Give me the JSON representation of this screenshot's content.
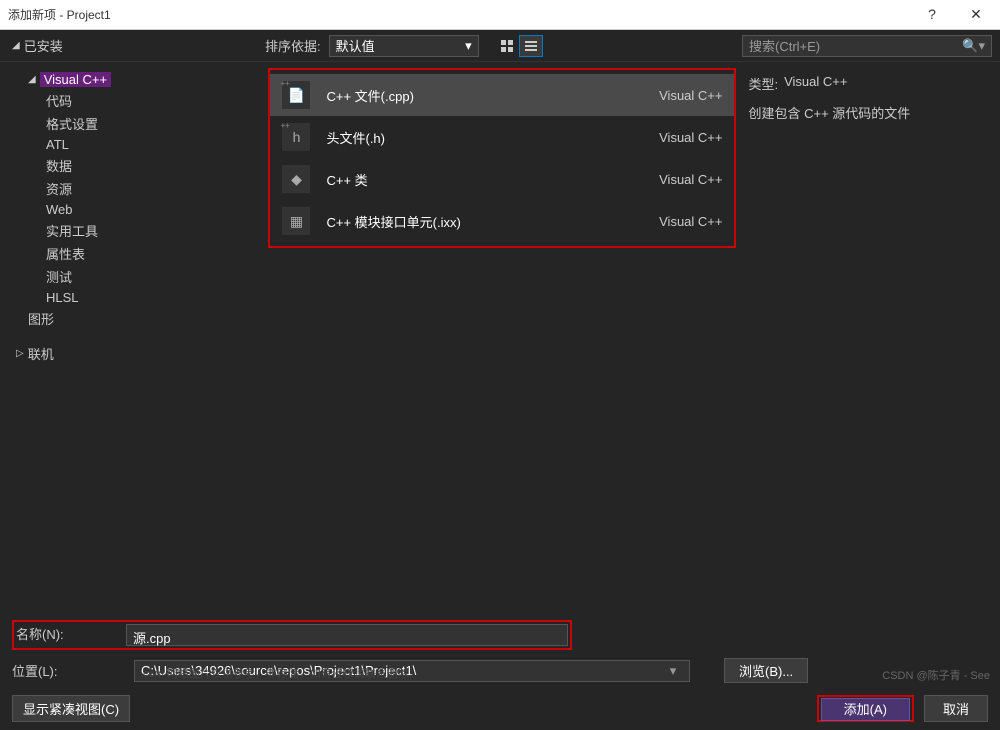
{
  "titlebar": {
    "title": "添加新项 - Project1"
  },
  "toolbar": {
    "installed": "已安装",
    "sort_label": "排序依据:",
    "sort_value": "默认值",
    "search_placeholder": "搜索(Ctrl+E)"
  },
  "sidebar": {
    "root": "Visual C++",
    "items": [
      "代码",
      "格式设置",
      "ATL",
      "数据",
      "资源",
      "Web",
      "实用工具",
      "属性表",
      "测试",
      "HLSL"
    ],
    "graphics": "图形",
    "online": "联机"
  },
  "templates": [
    {
      "name": "C++ 文件(.cpp)",
      "tag": "Visual C++",
      "icon": "cpp",
      "selected": true
    },
    {
      "name": "头文件(.h)",
      "tag": "Visual C++",
      "icon": "h",
      "selected": false
    },
    {
      "name": "C++ 类",
      "tag": "Visual C++",
      "icon": "class",
      "selected": false
    },
    {
      "name": "C++ 模块接口单元(.ixx)",
      "tag": "Visual C++",
      "icon": "module",
      "selected": false
    }
  ],
  "details": {
    "type_label": "类型:",
    "type_value": "Visual C++",
    "desc": "创建包含 C++ 源代码的文件"
  },
  "form": {
    "name_label": "名称(N):",
    "name_value": "源.cpp",
    "location_label": "位置(L):",
    "location_value": "C:\\Users\\34926\\source\\repos\\Project1\\Project1\\",
    "browse": "浏览(B)..."
  },
  "footer": {
    "compact": "显示紧凑视图(C)",
    "add": "添加(A)",
    "cancel": "取消"
  },
  "watermark": "CSDN @陈子青 - See",
  "watermark2": ".com 网络图片仅供参考，非存储，如有侵权请联系删除。"
}
